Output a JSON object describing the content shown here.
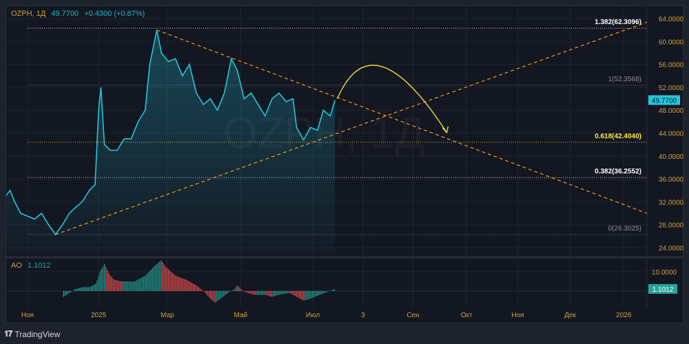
{
  "header": {
    "symbol": "OZPH, 1Д",
    "price": "49.7700",
    "change": "+0.4300 (+0.87%)"
  },
  "watermark": "OZPH, 1Д",
  "branding": {
    "name": "TradingView"
  },
  "colors": {
    "line": "#26c6da",
    "trend": "#f59e0b",
    "arc": "#ffeb3b",
    "up": "#26a69a",
    "down": "#ef5350",
    "axis_text": "#d1a13a"
  },
  "chart_data": [
    {
      "type": "line",
      "title": "OZPH, 1Д",
      "x_unit": "days since 1 Nov 2024",
      "ylim": [
        24,
        64
      ],
      "y_ticks": [
        "64.0000",
        "60.0000",
        "56.0000",
        "52.0000",
        "48.0000",
        "44.0000",
        "40.0000",
        "36.0000",
        "32.0000",
        "28.0000",
        "24.0000"
      ],
      "y_tick_values": [
        64,
        60,
        56,
        52,
        48,
        44,
        40,
        36,
        32,
        28,
        24
      ],
      "x_ticks": [
        {
          "label": "Ноя",
          "day": 0
        },
        {
          "label": "2025",
          "day": 61
        },
        {
          "label": "Мар",
          "day": 120
        },
        {
          "label": "Май",
          "day": 183
        },
        {
          "label": "Июл",
          "day": 245
        },
        {
          "label": "3",
          "day": 288
        },
        {
          "label": "Сен",
          "day": 331
        },
        {
          "label": "Окт",
          "day": 377
        },
        {
          "label": "Ноя",
          "day": 421
        },
        {
          "label": "Дек",
          "day": 466
        },
        {
          "label": "2026",
          "day": 512
        }
      ],
      "xlim": [
        -19,
        568
      ],
      "series": [
        {
          "name": "OZPH close",
          "points": [
            [
              -19,
              33
            ],
            [
              -15,
              34
            ],
            [
              -11,
              32
            ],
            [
              -6,
              30
            ],
            [
              0,
              29.5
            ],
            [
              6,
              29
            ],
            [
              12,
              30
            ],
            [
              18,
              28
            ],
            [
              24,
              26.3
            ],
            [
              30,
              28
            ],
            [
              36,
              30
            ],
            [
              41,
              31
            ],
            [
              47,
              32
            ],
            [
              53,
              34
            ],
            [
              58,
              35
            ],
            [
              61,
              48
            ],
            [
              63,
              52
            ],
            [
              66,
              42
            ],
            [
              71,
              41
            ],
            [
              77,
              41
            ],
            [
              83,
              43
            ],
            [
              89,
              43
            ],
            [
              95,
              46
            ],
            [
              101,
              48
            ],
            [
              105,
              56
            ],
            [
              111,
              62
            ],
            [
              115,
              58
            ],
            [
              121,
              56.5
            ],
            [
              127,
              57
            ],
            [
              133,
              54
            ],
            [
              139,
              56
            ],
            [
              145,
              51
            ],
            [
              151,
              49
            ],
            [
              157,
              50
            ],
            [
              163,
              48
            ],
            [
              169,
              51
            ],
            [
              175,
              57
            ],
            [
              180,
              55
            ],
            [
              186,
              50
            ],
            [
              192,
              51
            ],
            [
              198,
              49
            ],
            [
              204,
              47
            ],
            [
              210,
              50
            ],
            [
              216,
              51
            ],
            [
              222,
              49.5
            ],
            [
              228,
              50
            ],
            [
              231,
              45
            ],
            [
              237,
              42.8
            ],
            [
              243,
              45
            ],
            [
              249,
              44.5
            ],
            [
              254,
              48
            ],
            [
              260,
              47
            ],
            [
              264,
              49.77
            ]
          ]
        }
      ],
      "last_price_label": "49.7700",
      "fib_levels": [
        {
          "label": "1.382(62.3096)",
          "value": 62.3096,
          "color": "#ffffff"
        },
        {
          "label": "1(52.3568)",
          "value": 52.3568,
          "color": "#8a8e99"
        },
        {
          "label": "0.618(42.4040)",
          "value": 42.404,
          "color": "#ffeb3b"
        },
        {
          "label": "0.382(36.2552)",
          "value": 36.2552,
          "color": "#ffffff"
        },
        {
          "label": "0(26.3025)",
          "value": 26.3025,
          "color": "#8a8e99"
        }
      ],
      "trend_lines": [
        {
          "from": [
            111,
            62
          ],
          "to": [
            532,
            30
          ]
        },
        {
          "from": [
            24,
            26.3
          ],
          "to": [
            568,
            66
          ]
        }
      ],
      "arc": {
        "from": [
          266,
          50
        ],
        "peak": [
          296,
          55
        ],
        "to": [
          360,
          44.1
        ]
      }
    },
    {
      "type": "bar",
      "title": "AO",
      "value_label": "1.1012",
      "y_tick": "10.0000",
      "y_tick_value": 10,
      "key_points": [
        [
          31,
          -3
        ],
        [
          36,
          -1
        ],
        [
          41,
          1
        ],
        [
          47,
          2
        ],
        [
          53,
          2
        ],
        [
          59,
          4
        ],
        [
          62,
          10
        ],
        [
          66,
          14
        ],
        [
          70,
          9
        ],
        [
          74,
          6
        ],
        [
          80,
          5
        ],
        [
          86,
          5
        ],
        [
          92,
          5
        ],
        [
          101,
          8
        ],
        [
          109,
          13
        ],
        [
          115,
          16
        ],
        [
          118,
          13
        ],
        [
          127,
          8
        ],
        [
          136,
          6
        ],
        [
          145,
          3
        ],
        [
          151,
          0
        ],
        [
          157,
          -4
        ],
        [
          161,
          -6
        ],
        [
          166,
          -4
        ],
        [
          172,
          -1
        ],
        [
          178,
          1
        ],
        [
          180,
          3
        ],
        [
          185,
          0
        ],
        [
          189,
          -1
        ],
        [
          195,
          -2
        ],
        [
          204,
          -2
        ],
        [
          210,
          -3
        ],
        [
          216,
          -2
        ],
        [
          225,
          -1
        ],
        [
          237,
          -5
        ],
        [
          243,
          -4
        ],
        [
          251,
          -2
        ],
        [
          264,
          1.1
        ]
      ]
    }
  ]
}
